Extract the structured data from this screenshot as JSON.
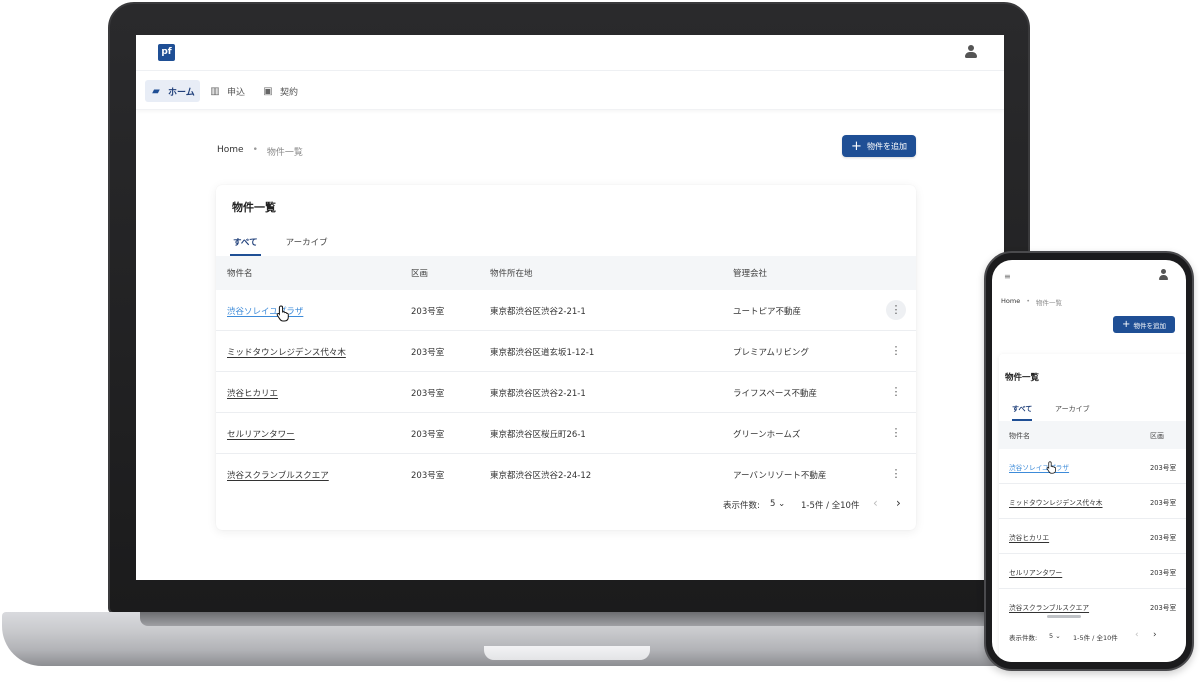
{
  "app": {
    "logo_text": "pf",
    "nav": [
      {
        "label": "ホーム",
        "icon": "home-icon",
        "active": true
      },
      {
        "label": "申込",
        "icon": "application-icon",
        "active": false
      },
      {
        "label": "契約",
        "icon": "contract-icon",
        "active": false
      }
    ]
  },
  "breadcrumb": {
    "home": "Home",
    "separator": "•",
    "current": "物件一覧"
  },
  "actions": {
    "add_property": "物件を追加"
  },
  "list": {
    "title": "物件一覧",
    "tabs": [
      {
        "label": "すべて",
        "active": true
      },
      {
        "label": "アーカイブ",
        "active": false
      }
    ],
    "columns": [
      "物件名",
      "区画",
      "物件所在地",
      "管理会社"
    ],
    "rows": [
      {
        "name": "渋谷ソレイユプラザ",
        "unit": "203号室",
        "address": "東京都渋谷区渋谷2-21-1",
        "company": "ユートピア不動産"
      },
      {
        "name": "ミッドタウンレジデンス代々木",
        "unit": "203号室",
        "address": "東京都渋谷区道玄坂1-12-1",
        "company": "プレミアムリビング"
      },
      {
        "name": "渋谷ヒカリエ",
        "unit": "203号室",
        "address": "東京都渋谷区渋谷2-21-1",
        "company": "ライフスペース不動産"
      },
      {
        "name": "セルリアンタワー",
        "unit": "203号室",
        "address": "東京都渋谷区桜丘町26-1",
        "company": "グリーンホームズ"
      },
      {
        "name": "渋谷スクランブルスクエア",
        "unit": "203号室",
        "address": "東京都渋谷区渋谷2-24-12",
        "company": "アーバンリゾート不動産"
      }
    ],
    "pagination": {
      "label": "表示件数:",
      "per_page": "5",
      "range": "1-5件 / 全10件"
    }
  },
  "colors": {
    "primary": "#1f4f95",
    "link_hover": "#3d8bd9",
    "header_bg": "#f4f6f8"
  }
}
